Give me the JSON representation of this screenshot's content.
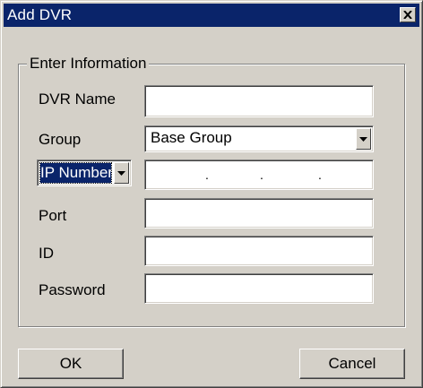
{
  "window": {
    "title": "Add DVR",
    "close_icon": "close-icon"
  },
  "group": {
    "legend": "Enter Information"
  },
  "fields": {
    "dvr_name": {
      "label": "DVR Name",
      "value": ""
    },
    "group": {
      "label": "Group",
      "value": "Base Group"
    },
    "address_type": {
      "selected": "IP Number"
    },
    "ip": {
      "value": ". . ."
    },
    "port": {
      "label": "Port",
      "value": ""
    },
    "id": {
      "label": "ID",
      "value": ""
    },
    "password": {
      "label": "Password",
      "value": ""
    }
  },
  "buttons": {
    "ok": "OK",
    "cancel": "Cancel"
  },
  "colors": {
    "titlebar": "#0a246a",
    "face": "#d4d0c8",
    "selection": "#0a246a"
  }
}
